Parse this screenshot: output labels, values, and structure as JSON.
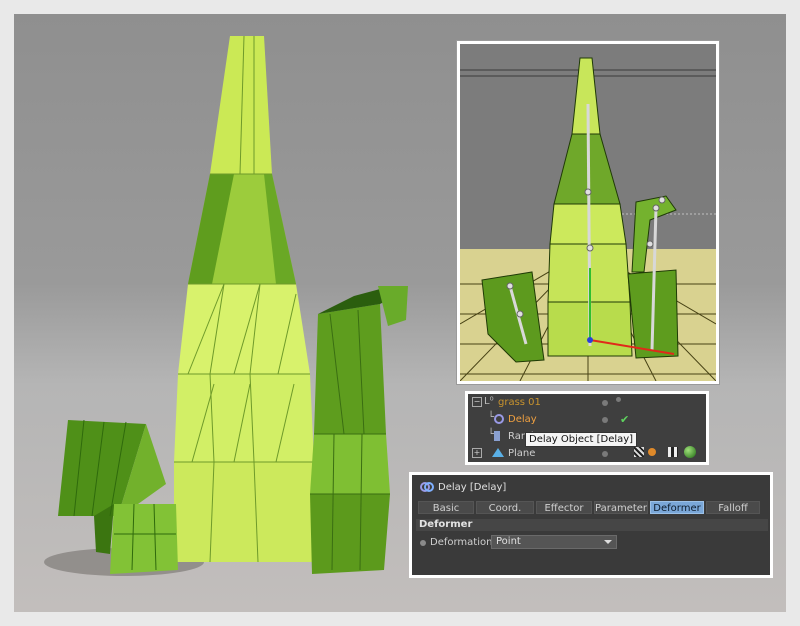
{
  "object_manager": {
    "rows": [
      {
        "name": "grass 01",
        "icon": "null-object-icon",
        "color": "#c8932e"
      },
      {
        "name": "Delay",
        "icon": "delay-effector-icon",
        "color": "#f0a040"
      },
      {
        "name": "Random",
        "icon": "random-effector-icon",
        "color": "#cfcfcf"
      },
      {
        "name": "Plane",
        "icon": "plane-object-icon",
        "color": "#cfcfcf"
      }
    ],
    "tooltip": "Delay Object [Delay]"
  },
  "attributes": {
    "title": "Delay [Delay]",
    "tabs": [
      "Basic",
      "Coord.",
      "Effector",
      "Parameter",
      "Deformer",
      "Falloff"
    ],
    "active_tab": "Deformer",
    "section": "Deformer",
    "property_label": "Deformation",
    "property_value": "Point"
  },
  "colors": {
    "grass_light": "#d9f26a",
    "grass_dark": "#4f8f1a",
    "active_tab": "#7aa7d8"
  }
}
